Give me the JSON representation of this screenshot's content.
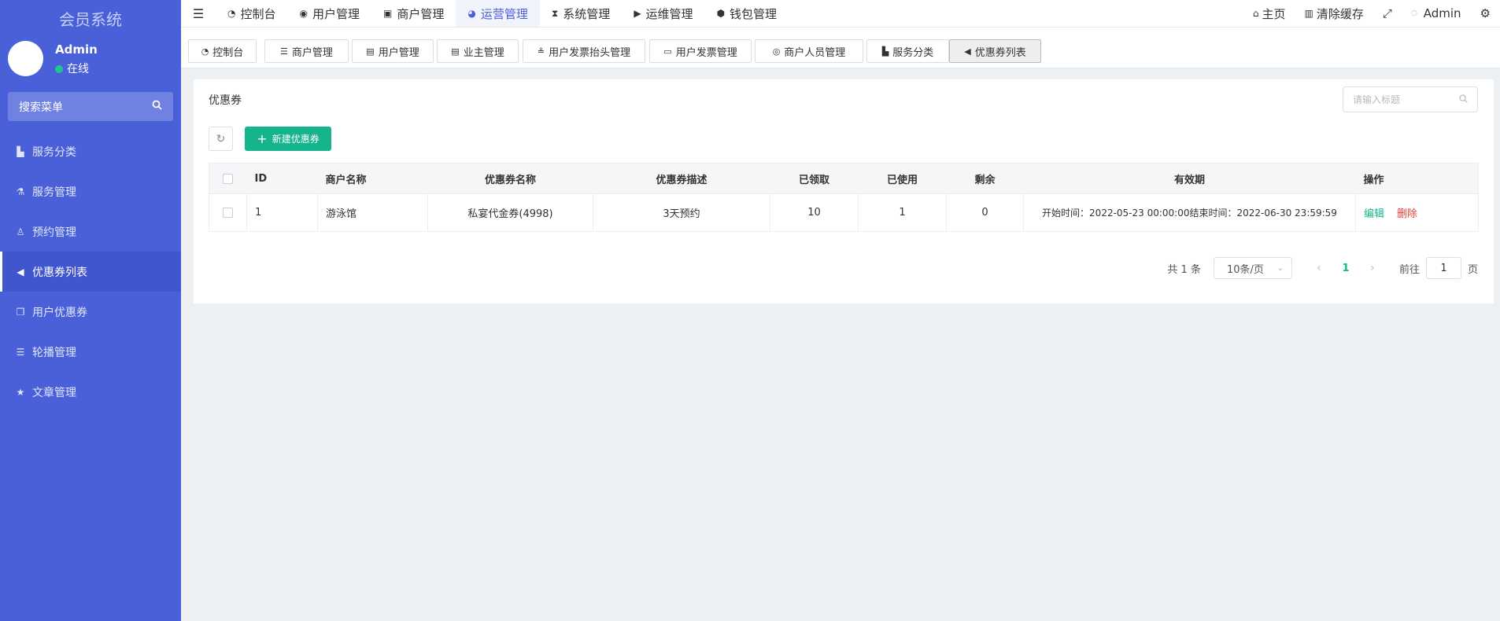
{
  "sidebar": {
    "brand": "会员系统",
    "user": {
      "name": "Admin",
      "status": "在线"
    },
    "search_placeholder": "搜索菜单",
    "items": [
      {
        "label": "服务分类",
        "icon": "hotel-icon"
      },
      {
        "label": "服务管理",
        "icon": "binoculars-icon"
      },
      {
        "label": "预约管理",
        "icon": "person-walking-icon"
      },
      {
        "label": "优惠券列表",
        "icon": "bullhorn-icon",
        "active": true
      },
      {
        "label": "用户优惠券",
        "icon": "copy-icon"
      },
      {
        "label": "轮播管理",
        "icon": "sliders-icon"
      },
      {
        "label": "文章管理",
        "icon": "star-icon"
      }
    ]
  },
  "topnav": {
    "items": [
      {
        "label": "控制台",
        "icon": "dashboard-icon"
      },
      {
        "label": "用户管理",
        "icon": "user-circle-icon"
      },
      {
        "label": "商户管理",
        "icon": "shop-icon"
      },
      {
        "label": "运营管理",
        "icon": "operations-icon",
        "active": true
      },
      {
        "label": "系统管理",
        "icon": "hourglass-icon"
      },
      {
        "label": "运维管理",
        "icon": "play-square-icon"
      },
      {
        "label": "钱包管理",
        "icon": "cube-icon"
      }
    ],
    "right": {
      "home": "主页",
      "clear_cache": "清除缓存",
      "user": "Admin"
    }
  },
  "tabs": [
    {
      "label": "控制台",
      "icon": "dashboard-icon"
    },
    {
      "label": "商户管理",
      "icon": "list-icon"
    },
    {
      "label": "用户管理",
      "icon": "id-card-icon"
    },
    {
      "label": "业主管理",
      "icon": "id-card-icon"
    },
    {
      "label": "用户发票抬头管理",
      "icon": "stamp-icon"
    },
    {
      "label": "用户发票管理",
      "icon": "keyboard-icon"
    },
    {
      "label": "商户人员管理",
      "icon": "eye-slash-icon"
    },
    {
      "label": "服务分类",
      "icon": "hotel-icon"
    },
    {
      "label": "优惠券列表",
      "icon": "bullhorn-icon",
      "active": true
    }
  ],
  "panel": {
    "title": "优惠券",
    "search_placeholder": "请输入标题",
    "add_button": "新建优惠券",
    "columns": [
      "ID",
      "商户名称",
      "优惠券名称",
      "优惠券描述",
      "已领取",
      "已使用",
      "剩余",
      "有效期",
      "操作"
    ],
    "rows": [
      {
        "id": "1",
        "merchant": "游泳馆",
        "name": "私宴代金券(4998)",
        "desc": "3天预约",
        "received": "10",
        "used": "1",
        "remaining": "0",
        "validity": "开始时间：2022-05-23 00:00:00结束时间：2022-06-30 23:59:59",
        "edit": "编辑",
        "delete": "删除"
      }
    ],
    "pagination": {
      "total": "共 1 条",
      "page_size": "10条/页",
      "current_page": "1",
      "goto_label": "前往",
      "goto_value": "1",
      "goto_suffix": "页"
    }
  },
  "colors": {
    "sidebar_bg": "#4960d8",
    "accent": "#4960d8",
    "primary_button": "#16b48c",
    "danger": "#f04134",
    "online": "#21c68f"
  }
}
